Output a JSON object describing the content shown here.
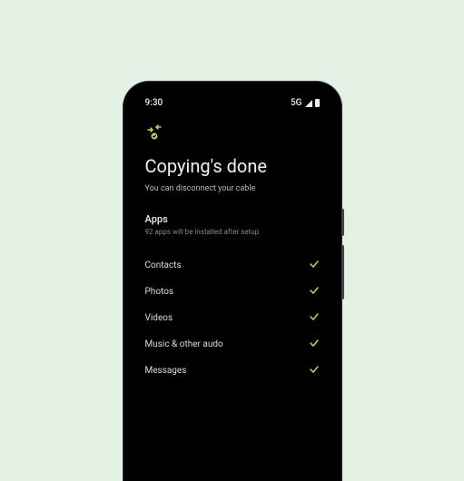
{
  "statusbar": {
    "time": "9:30",
    "network": "5G"
  },
  "page": {
    "title": "Copying's done",
    "subtitle": "You can disconnect your cable"
  },
  "apps_section": {
    "title": "Apps",
    "subtitle": "92 apps will be installed after setup"
  },
  "items": [
    {
      "label": "Contacts"
    },
    {
      "label": "Photos"
    },
    {
      "label": "Videos"
    },
    {
      "label": "Music & other audo"
    },
    {
      "label": "Messages"
    }
  ],
  "colors": {
    "accent": "#bada55",
    "background": "#e3f2e4"
  }
}
